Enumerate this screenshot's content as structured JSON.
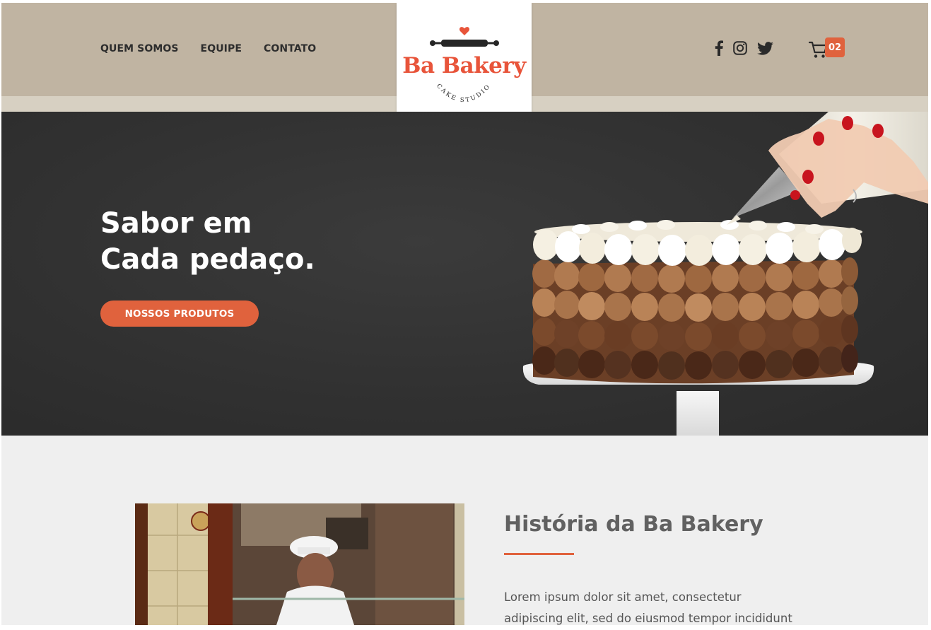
{
  "nav": {
    "items": [
      {
        "label": "QUEM SOMOS"
      },
      {
        "label": "EQUIPE"
      },
      {
        "label": "CONTATO"
      }
    ]
  },
  "logo": {
    "name": "Ba Bakery",
    "tagline": "CAKE STUDIO"
  },
  "cart": {
    "count": "02"
  },
  "social": [
    "facebook-icon",
    "instagram-icon",
    "twitter-icon"
  ],
  "hero": {
    "title_line1": "Sabor em",
    "title_line2": "Cada pedaço.",
    "button_label": "NOSSOS PRODUTOS"
  },
  "history": {
    "title": "História da Ba Bakery",
    "text": "Lorem ipsum dolor sit amet, consectetur adipiscing elit, sed do eiusmod tempor incididunt ut labore et"
  },
  "colors": {
    "accent": "#e0623d",
    "header_bg": "#c0b4a2",
    "hero_bg": "#333333",
    "logo_red": "#e8543a"
  }
}
